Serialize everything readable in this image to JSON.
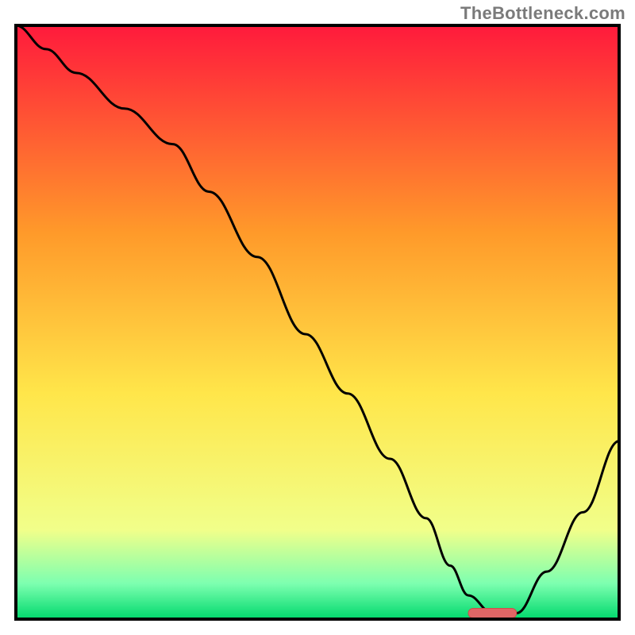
{
  "watermark": "TheBottleneck.com",
  "colors": {
    "gradient_top": "#ff1a3c",
    "gradient_mid1": "#ff9a2a",
    "gradient_mid2": "#ffe64a",
    "gradient_bottom1": "#f1ff8a",
    "gradient_bottom2": "#7dffb0",
    "gradient_bottom3": "#00d96d",
    "line": "#000000",
    "marker_fill": "#e06666",
    "marker_stroke": "#d24a4a",
    "frame": "#000000"
  },
  "chart_data": {
    "type": "line",
    "title": "",
    "xlabel": "",
    "ylabel": "",
    "xlim": [
      0,
      100
    ],
    "ylim": [
      0,
      100
    ],
    "x": [
      0,
      5,
      10,
      18,
      26,
      32,
      40,
      48,
      55,
      62,
      68,
      72,
      75,
      79,
      83,
      88,
      94,
      100
    ],
    "values": [
      100,
      96,
      92,
      86,
      80,
      72,
      61,
      48,
      38,
      27,
      17,
      9,
      4,
      1,
      1,
      8,
      18,
      30
    ],
    "marker": {
      "x_start": 75,
      "x_end": 83,
      "y": 1
    }
  }
}
